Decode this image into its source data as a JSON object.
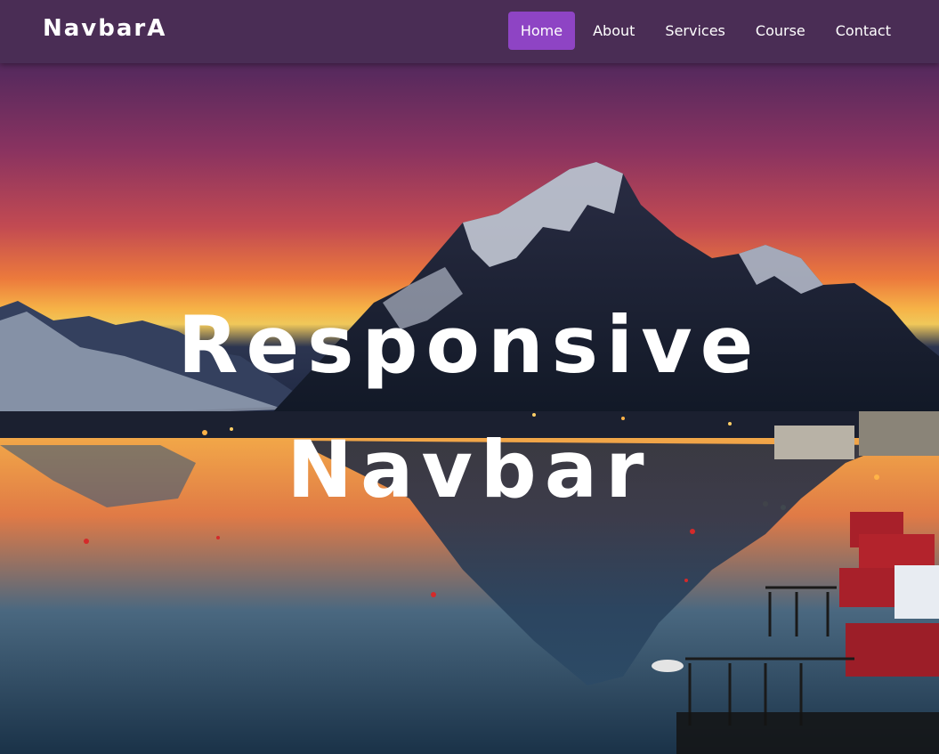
{
  "navbar": {
    "brand": "NavbarA",
    "links": [
      {
        "label": "Home",
        "active": true
      },
      {
        "label": "About",
        "active": false
      },
      {
        "label": "Services",
        "active": false
      },
      {
        "label": "Course",
        "active": false
      },
      {
        "label": "Contact",
        "active": false
      }
    ],
    "active_color": "#8e44c4",
    "background_color": "#4a2d55"
  },
  "hero": {
    "title_line1": "Responsive",
    "title_line2": "Navbar"
  }
}
